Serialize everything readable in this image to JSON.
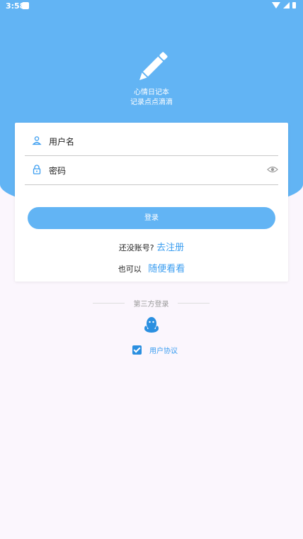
{
  "status_bar": {
    "time": "3:58"
  },
  "header": {
    "app_name": "心情日记本",
    "slogan": "记录点点滴滴"
  },
  "form": {
    "username_label": "用户名",
    "password_label": "密码",
    "login_label": "登录",
    "no_account_text": "还没账号?",
    "register_link": "去注册",
    "guest_prefix": "也可以",
    "guest_link": "随便看看"
  },
  "third_party": {
    "label": "第三方登录",
    "icon": "qq-icon"
  },
  "agreement": {
    "checked": true,
    "label": "用户协议"
  },
  "colors": {
    "accent": "#62b4f4",
    "link": "#3a9df0",
    "background": "#fbf6fd"
  }
}
